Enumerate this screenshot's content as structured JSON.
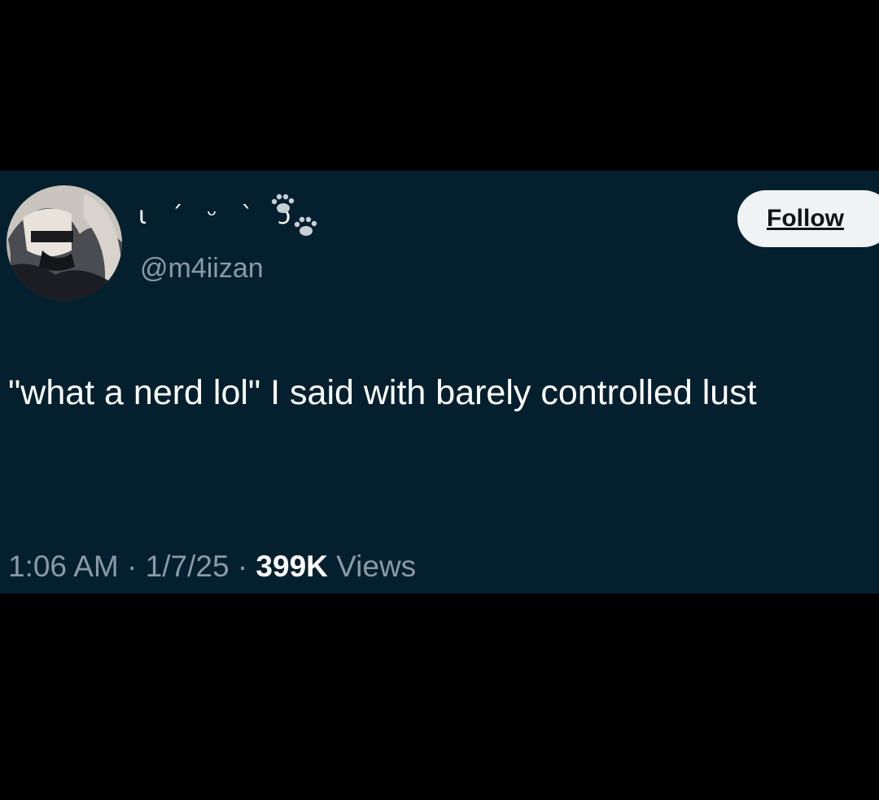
{
  "tweet": {
    "display_name": "ɩ ´ ᵕ ` ᴐ",
    "handle": "@m4iizan",
    "follow_label": "Follow",
    "text": "\"what a nerd lol\" I said with barely controlled lust",
    "time": "1:06 AM",
    "separator": "·",
    "date": "1/7/25",
    "views_count": "399K",
    "views_label": "Views"
  },
  "colors": {
    "page_background": "#000000",
    "card_background": "#04202f",
    "primary_text": "#ffffff",
    "secondary_text": "#8b99a6",
    "follow_button_bg": "#eff3f4",
    "follow_button_text": "#0f1419"
  },
  "icons": {
    "avatar": "avatar-image",
    "name_decoration": "paw-prints-icon"
  }
}
